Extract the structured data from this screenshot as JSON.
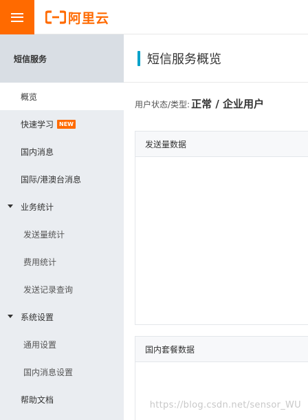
{
  "brand": {
    "name": "阿里云",
    "accent_color": "#ff6a00",
    "menu_icon": "hamburger-icon",
    "logo_icon": "aliyun-bracket-logo"
  },
  "sidebar": {
    "header": "短信服务",
    "items": [
      {
        "label": "概览",
        "level": "level1",
        "active": true
      },
      {
        "label": "快速学习",
        "level": "level1",
        "badge": "NEW"
      },
      {
        "label": "国内消息",
        "level": "level1"
      },
      {
        "label": "国际/港澳台消息",
        "level": "level1"
      },
      {
        "label": "业务统计",
        "level": "group",
        "expanded": true
      },
      {
        "label": "发送量统计",
        "level": "level2"
      },
      {
        "label": "费用统计",
        "level": "level2"
      },
      {
        "label": "发送记录查询",
        "level": "level2"
      },
      {
        "label": "系统设置",
        "level": "group",
        "expanded": true
      },
      {
        "label": "通用设置",
        "level": "level2"
      },
      {
        "label": "国内消息设置",
        "level": "level2"
      },
      {
        "label": "帮助文档",
        "level": "level1"
      }
    ]
  },
  "main": {
    "title": "短信服务概览",
    "title_accent_color": "#00a2ca",
    "status_label": "用户状态/类型:",
    "status_value": "正常 / 企业用户",
    "panels": [
      {
        "title": "发送量数据"
      },
      {
        "title": "国内套餐数据"
      }
    ]
  },
  "watermark": "https://blog.csdn.net/sensor_WU"
}
